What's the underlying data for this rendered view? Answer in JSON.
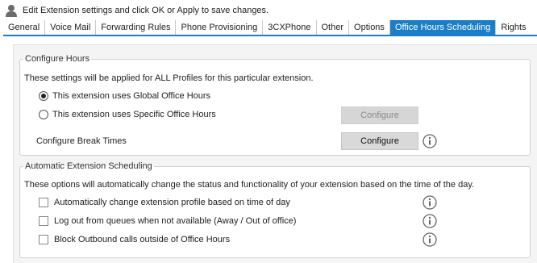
{
  "header": {
    "icon": "user-icon",
    "text": "Edit Extension settings and click OK or Apply to save changes."
  },
  "tabs": [
    {
      "label": "General"
    },
    {
      "label": "Voice Mail"
    },
    {
      "label": "Forwarding Rules"
    },
    {
      "label": "Phone Provisioning"
    },
    {
      "label": "3CXPhone"
    },
    {
      "label": "Other"
    },
    {
      "label": "Options"
    },
    {
      "label": "Office Hours Scheduling",
      "active": true
    },
    {
      "label": "Rights"
    }
  ],
  "configure_hours": {
    "legend": "Configure Hours",
    "description": "These settings will be applied for ALL Profiles for this particular extension.",
    "options": [
      {
        "label": "This extension uses Global Office Hours",
        "checked": true
      },
      {
        "label": "This extension uses Specific Office Hours",
        "checked": false
      }
    ],
    "configure_button": "Configure",
    "break_times_label": "Configure Break Times",
    "break_times_button": "Configure"
  },
  "auto_scheduling": {
    "legend": "Automatic Extension Scheduling",
    "description": "These options will automatically change the status and functionality of your extension based on the time of the day.",
    "options": [
      {
        "label": "Automatically change extension profile based on time of day",
        "checked": false
      },
      {
        "label": "Log out from queues when not available (Away / Out of office)",
        "checked": false
      },
      {
        "label": "Block Outbound calls outside of Office Hours",
        "checked": false
      }
    ]
  },
  "colors": {
    "accent": "#1a7fc9",
    "panel_bg": "#f4f4f4",
    "button_bg": "#d9d9d9"
  }
}
